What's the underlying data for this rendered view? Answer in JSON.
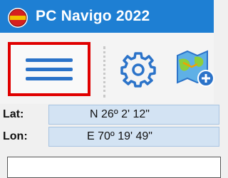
{
  "window": {
    "title": "PC Navigo 2022"
  },
  "toolbar": {
    "menu_icon": "hamburger-menu-icon",
    "settings_icon": "gear-icon",
    "map_icon": "map-add-icon"
  },
  "coords": {
    "lat_label": "Lat:",
    "lat_value": "N 26º 2' 12\"",
    "lon_label": "Lon:",
    "lon_value": "E 70º 19' 49\""
  },
  "colors": {
    "titlebar": "#1e7fd3",
    "highlight": "#e00000",
    "icon_blue": "#2b73c9",
    "coord_bg": "#d3e3f3"
  }
}
